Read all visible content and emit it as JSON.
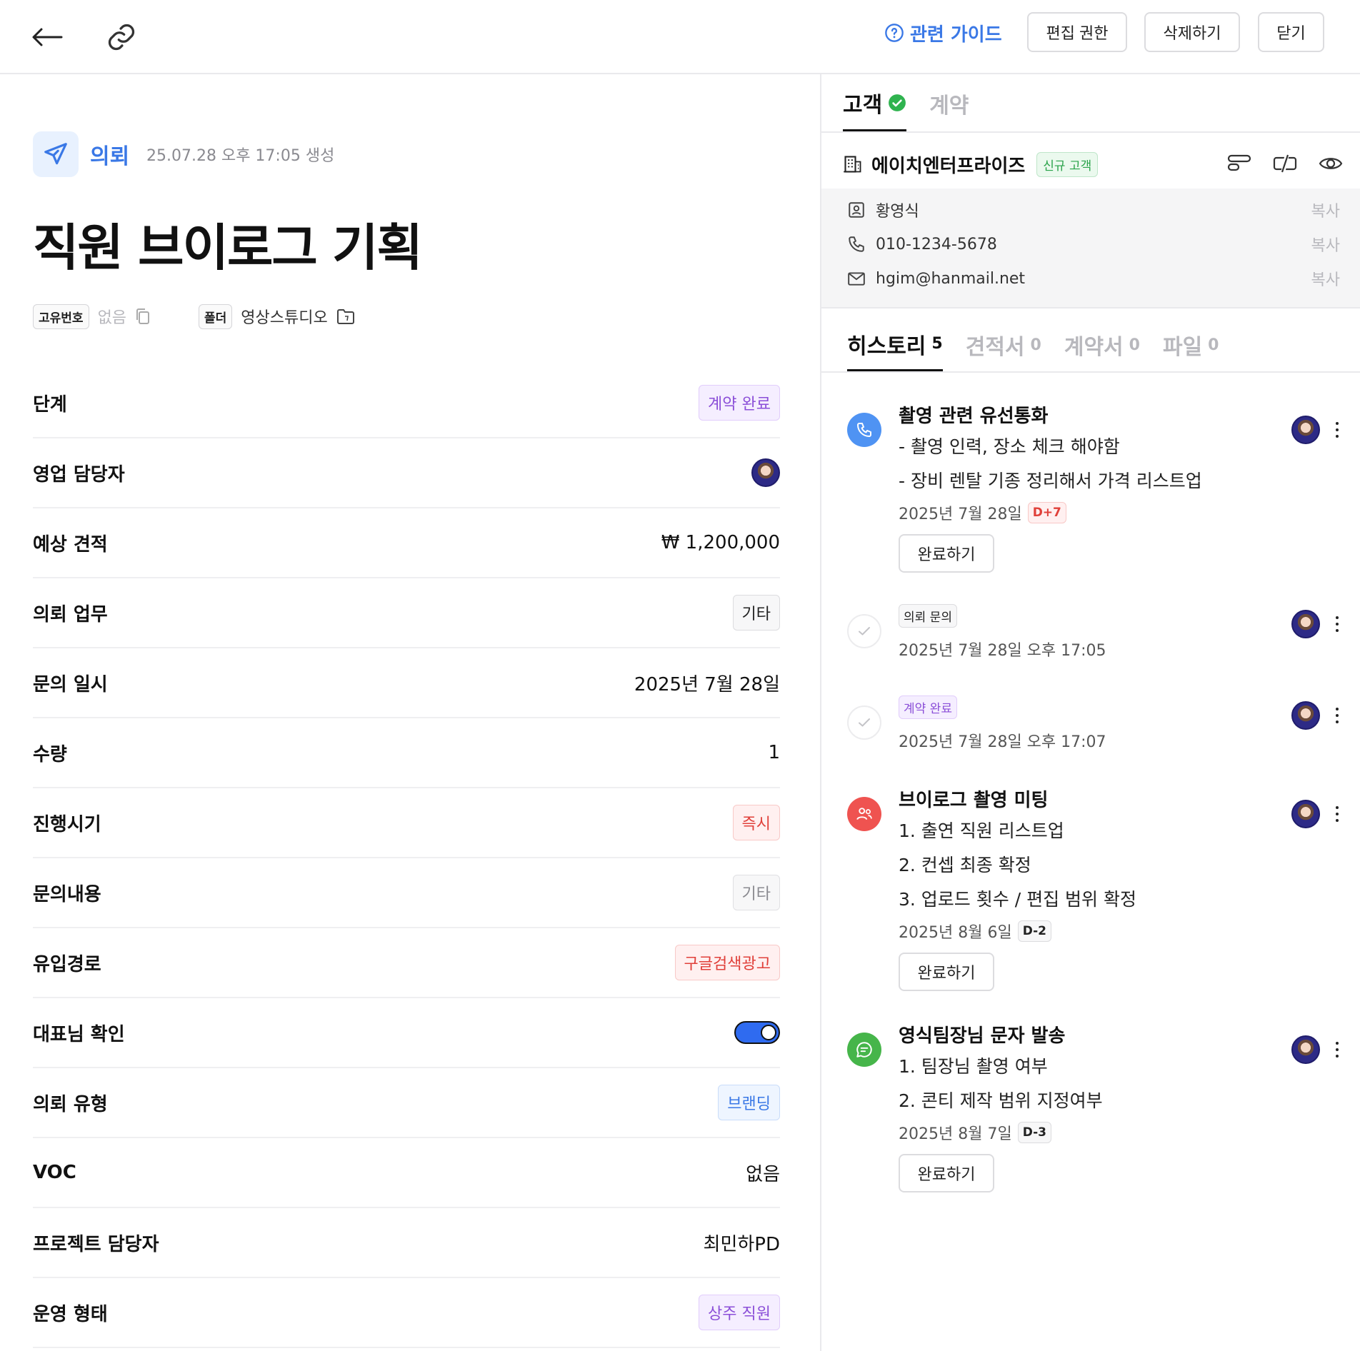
{
  "topbar": {
    "back_icon": "arrow-left-icon",
    "link_icon": "link-icon",
    "guide_label": "관련 가이드",
    "edit_permission_label": "편집 권한",
    "delete_label": "삭제하기",
    "close_label": "닫기"
  },
  "detail": {
    "type_label": "의뢰",
    "created": "25.07.28 오후 17:05 생성",
    "title": "직원 브이로그 기획",
    "id_tag": "고유번호",
    "id_value": "없음",
    "folder_tag": "폴더",
    "folder_value": "영상스튜디오",
    "rows": [
      {
        "label": "단계",
        "value": "계약 완료"
      },
      {
        "label": "영업 담당자",
        "value": ""
      },
      {
        "label": "예상 견적",
        "value": "₩ 1,200,000"
      },
      {
        "label": "의뢰 업무",
        "value": "기타"
      },
      {
        "label": "문의 일시",
        "value": "2025년 7월 28일"
      },
      {
        "label": "수량",
        "value": "1"
      },
      {
        "label": "진행시기",
        "value": "즉시"
      },
      {
        "label": "문의내용",
        "value": "기타"
      },
      {
        "label": "유입경로",
        "value": "구글검색광고"
      },
      {
        "label": "대표님 확인",
        "value": "on"
      },
      {
        "label": "의뢰 유형",
        "value": "브랜딩"
      },
      {
        "label": "VOC",
        "value": "없음"
      },
      {
        "label": "프로젝트 담당자",
        "value": "최민하PD"
      },
      {
        "label": "운영 형태",
        "value": "상주 직원"
      }
    ]
  },
  "side": {
    "tabs": [
      {
        "label": "고객",
        "verified_icon": "check-circle-icon"
      },
      {
        "label": "계약"
      }
    ],
    "customer": {
      "name": "에이치엔터프라이즈",
      "badge": "신규 고객",
      "contact_name": "황영식",
      "phone": "010-1234-5678",
      "email": "hgim@hanmail.net",
      "copy_label": "복사"
    },
    "history_tabs": [
      {
        "label": "히스토리",
        "count": "5"
      },
      {
        "label": "견적서",
        "count": "0"
      },
      {
        "label": "계약서",
        "count": "0"
      },
      {
        "label": "파일",
        "count": "0"
      }
    ],
    "history": [
      {
        "title": "촬영 관련 유선통화",
        "lines": [
          "- 촬영 인력, 장소 체크 해야함",
          "- 장비 렌탈 기종 정리해서 가격 리스트업"
        ],
        "date": "2025년 7월 28일",
        "badge": "D+7",
        "button": "완료하기"
      },
      {
        "tag": "의뢰 문의",
        "date": "2025년 7월 28일 오후 17:05"
      },
      {
        "tag": "계약 완료",
        "date": "2025년 7월 28일 오후 17:07"
      },
      {
        "title": "브이로그 촬영 미팅",
        "lines": [
          "1. 출연 직원 리스트업",
          "2. 컨셉 최종 확정",
          "3. 업로드 횟수 / 편집 범위 확정"
        ],
        "date": "2025년 8월 6일",
        "badge": "D-2",
        "button": "완료하기"
      },
      {
        "title": "영식팀장님 문자 발송",
        "lines": [
          "1. 팀장님 촬영 여부",
          "2. 콘티 제작 범위 지정여부"
        ],
        "date": "2025년 8월 7일",
        "badge": "D-3",
        "button": "완료하기"
      }
    ]
  },
  "colors": {
    "accent_blue": "#3a78e6",
    "phone_icon_bg": "#4f93f3",
    "meeting_icon_bg": "#ef5350",
    "message_icon_bg": "#46b54a",
    "toggle_on": "#2f6bf0"
  }
}
